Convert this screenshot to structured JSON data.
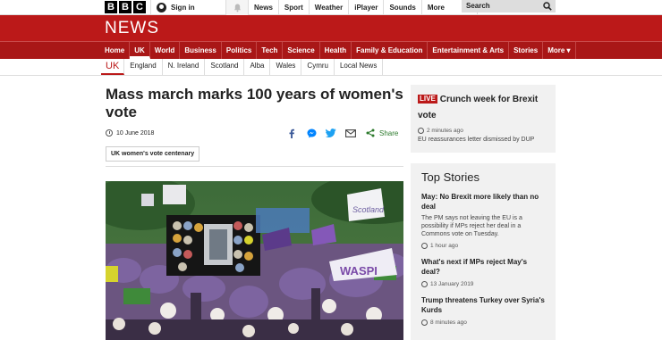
{
  "header": {
    "logo_letters": [
      "B",
      "B",
      "C"
    ],
    "signin_label": "Sign in",
    "top_nav": [
      "News",
      "Sport",
      "Weather",
      "iPlayer",
      "Sounds",
      "More"
    ],
    "search_placeholder": "Search"
  },
  "news_band": {
    "title": "NEWS",
    "nav": [
      "Home",
      "UK",
      "World",
      "Business",
      "Politics",
      "Tech",
      "Science",
      "Health",
      "Family & Education",
      "Entertainment & Arts",
      "Stories",
      "More ▾"
    ],
    "active": "UK"
  },
  "sub_nav": {
    "items": [
      "UK",
      "England",
      "N. Ireland",
      "Scotland",
      "Alba",
      "Wales",
      "Cymru",
      "Local News"
    ],
    "active": "UK"
  },
  "article": {
    "headline": "Mass march marks 100 years of women's vote",
    "date": "10 June 2018",
    "share_label": "Share",
    "tag": "UK women's vote centenary"
  },
  "live": {
    "badge": "LIVE",
    "title": "Crunch week for Brexit vote",
    "time": "2 minutes ago",
    "summary": "EU reassurances letter dismissed by DUP"
  },
  "top_stories": {
    "heading": "Top Stories",
    "items": [
      {
        "title": "May: No Brexit more likely than no deal",
        "summary": "The PM says not leaving the EU is a possibility if MPs reject her deal in a Commons vote on Tuesday.",
        "time": "1 hour ago"
      },
      {
        "title": "What's next if MPs reject May's deal?",
        "summary": "",
        "time": "13 January 2019"
      },
      {
        "title": "Trump threatens Turkey over Syria's Kurds",
        "summary": "",
        "time": "8 minutes ago"
      }
    ]
  },
  "photo_banner_texts": [
    "WASPI",
    "Scotland"
  ],
  "colors": {
    "brand_red": "#bb1919",
    "nav_red": "#a91717",
    "share_green": "#2c7a2c",
    "facebook_blue": "#3b5998",
    "messenger_blue": "#0084ff",
    "twitter_blue": "#1da1f2"
  }
}
